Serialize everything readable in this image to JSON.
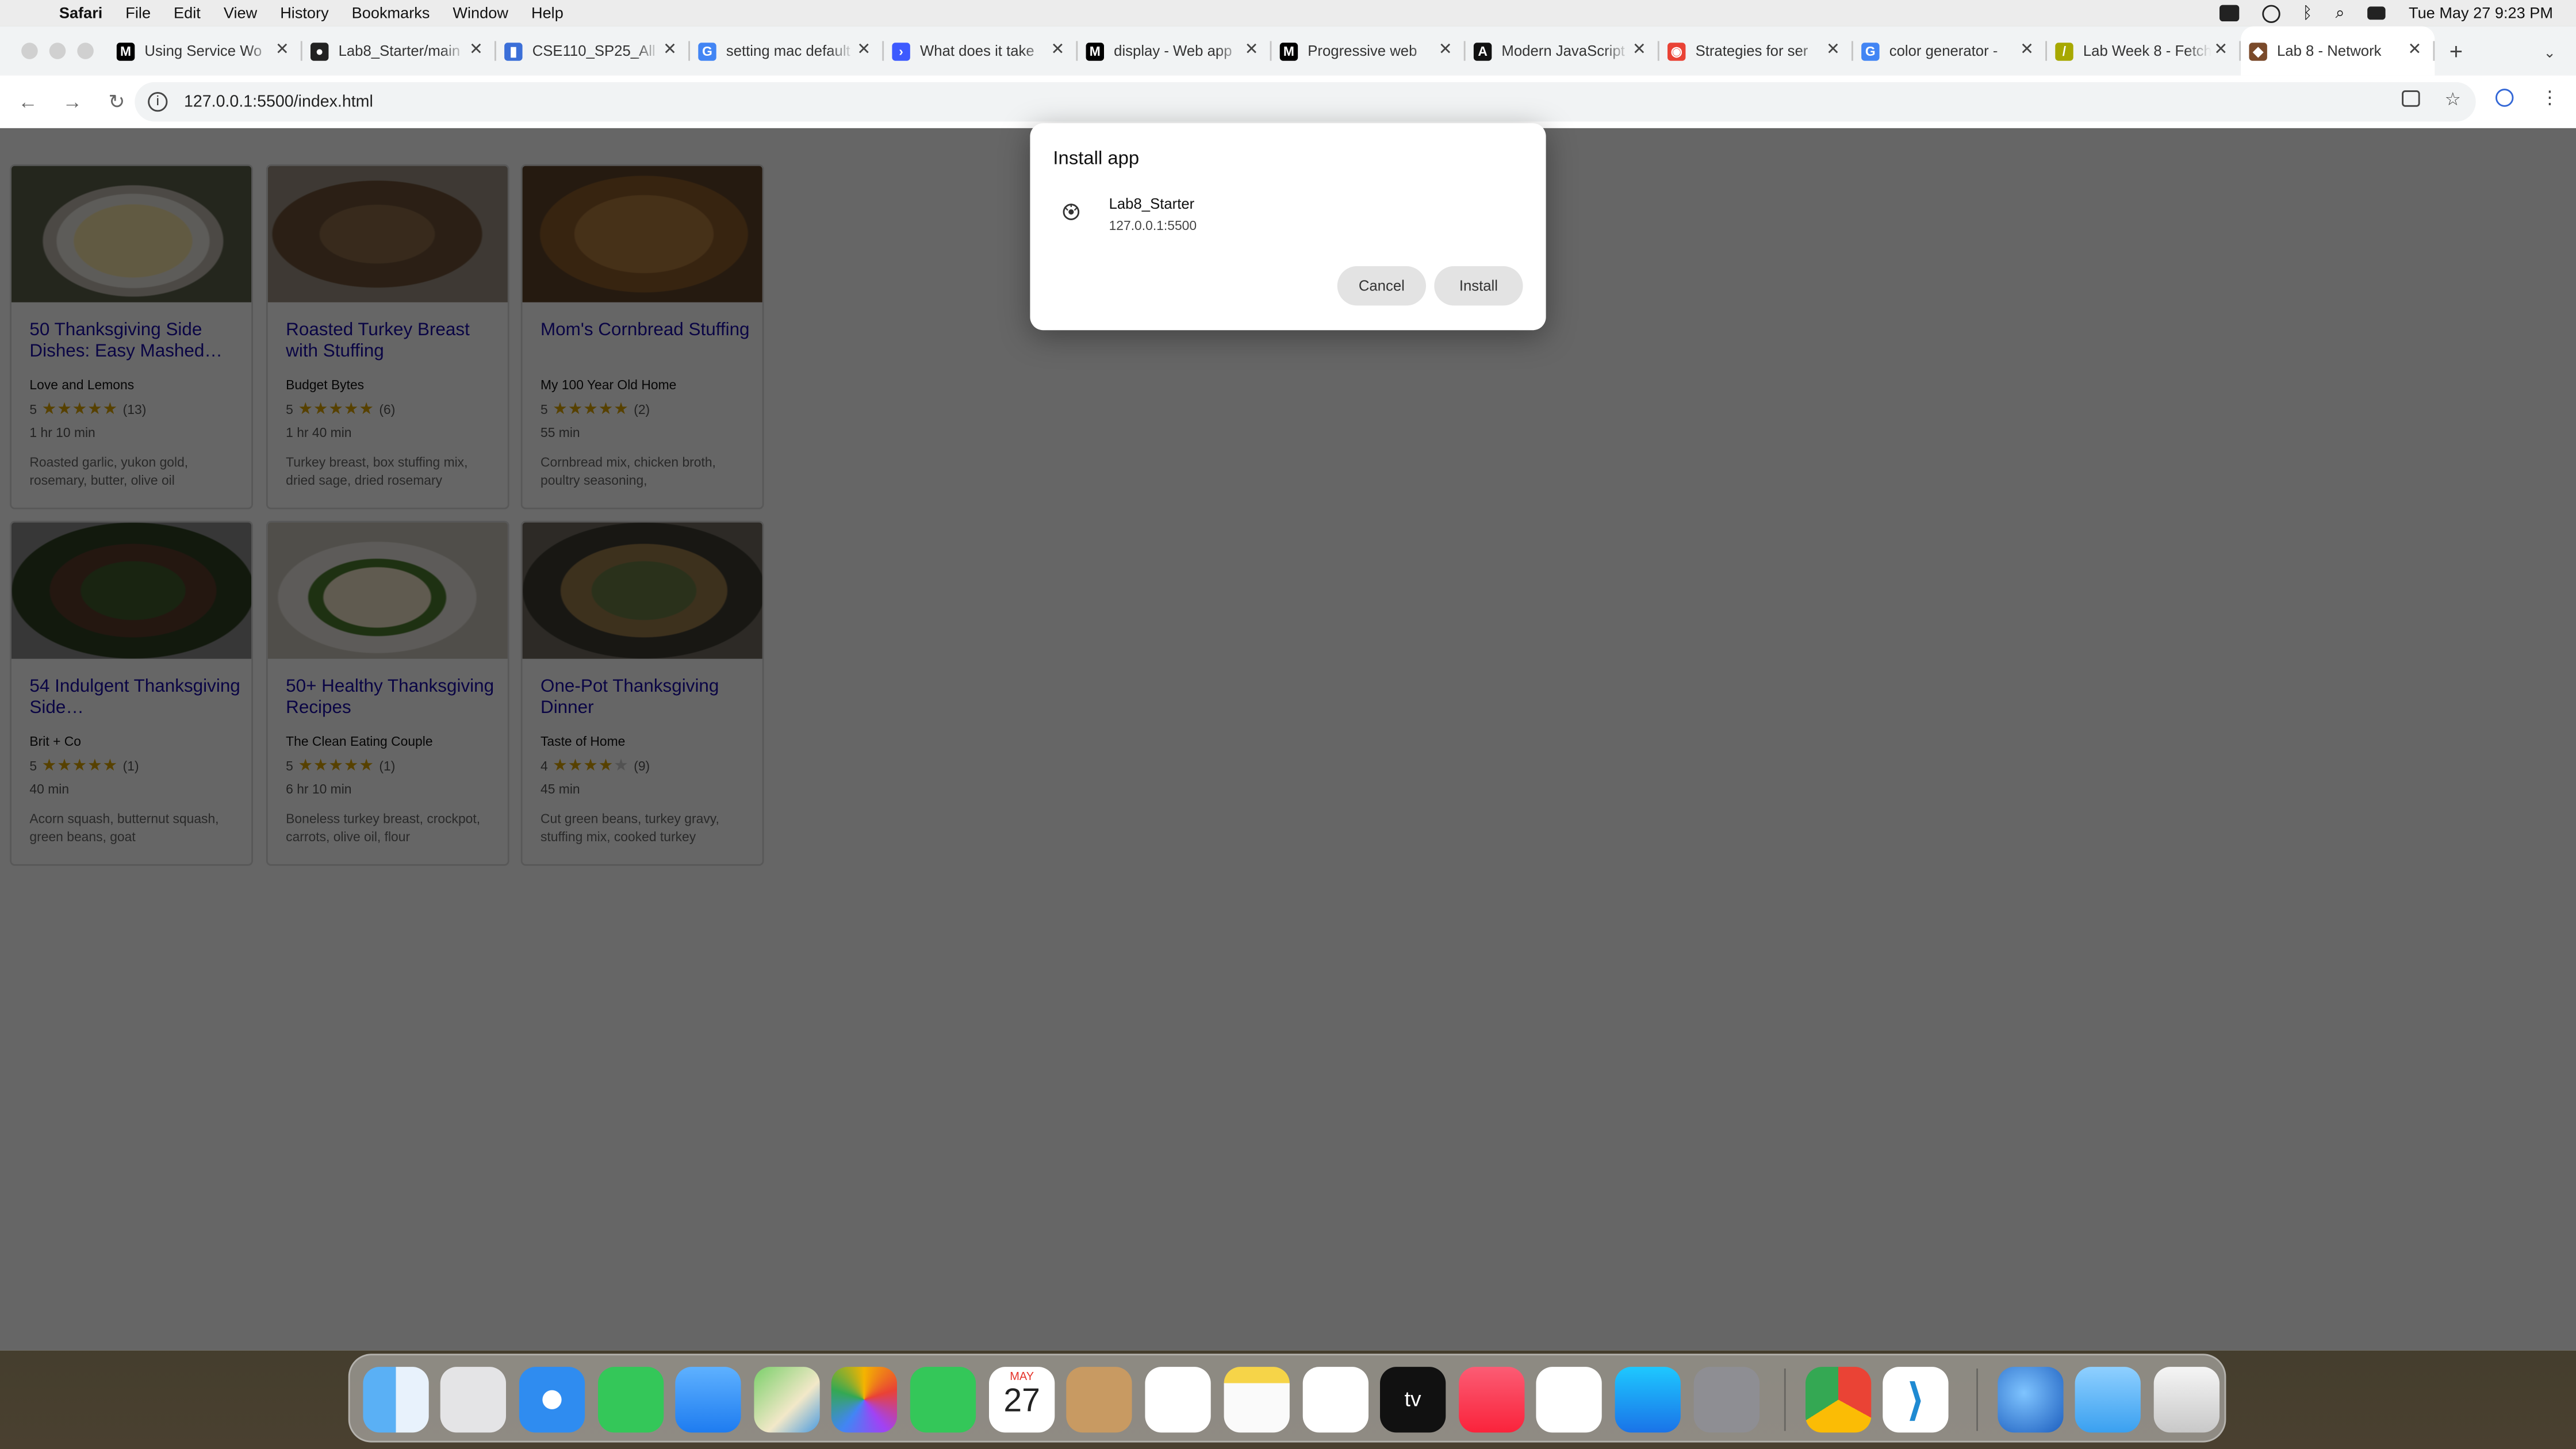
{
  "menubar": {
    "app": "Safari",
    "items": [
      "File",
      "Edit",
      "View",
      "History",
      "Bookmarks",
      "Window",
      "Help"
    ],
    "clock": "Tue May 27  9:23 PM"
  },
  "tabs": [
    {
      "label": "Using Service Wo",
      "icon": "M",
      "color": "#000"
    },
    {
      "label": "Lab8_Starter/main",
      "icon": "gh",
      "color": "#222"
    },
    {
      "label": "CSE110_SP25_All",
      "icon": "bar",
      "color": "#3b6fd8"
    },
    {
      "label": "setting mac default",
      "icon": "G",
      "color": "#4285f4"
    },
    {
      "label": "What does it take",
      "icon": "arrow",
      "color": "#3d5afe"
    },
    {
      "label": "display - Web app",
      "icon": "M",
      "color": "#000"
    },
    {
      "label": "Progressive web",
      "icon": "M",
      "color": "#000"
    },
    {
      "label": "Modern JavaScript",
      "icon": "A",
      "color": "#111"
    },
    {
      "label": "Strategies for ser",
      "icon": "chrome",
      "color": "#e94235"
    },
    {
      "label": "color generator -",
      "icon": "G",
      "color": "#4285f4"
    },
    {
      "label": "Lab Week 8 - Fetch",
      "icon": "slash",
      "color": "#a7a800"
    },
    {
      "label": "Lab 8 - Network",
      "icon": "turkey",
      "color": "#7a4a2a"
    }
  ],
  "url": "127.0.0.1:5500/index.html",
  "recipes": [
    {
      "title": "50 Thanksgiving Side Dishes: Easy Mashed…",
      "org": "Love and Lemons",
      "rating": 5,
      "count": "(13)",
      "time": "1 hr 10 min",
      "ingredients": "Roasted garlic, yukon gold, rosemary, butter, olive oil",
      "img": "mash"
    },
    {
      "title": "Roasted Turkey Breast with Stuffing",
      "org": "Budget Bytes",
      "rating": 5,
      "count": "(6)",
      "time": "1 hr 40 min",
      "ingredients": "Turkey breast, box stuffing mix, dried sage, dried rosemary",
      "img": "turkey"
    },
    {
      "title": "Mom's Cornbread Stuffing",
      "org": "My 100 Year Old Home",
      "rating": 5,
      "count": "(2)",
      "time": "55 min",
      "ingredients": "Cornbread mix, chicken broth, poultry seasoning,",
      "img": "stuffing"
    },
    {
      "title": "54 Indulgent Thanksgiving Side…",
      "org": "Brit + Co",
      "rating": 5,
      "count": "(1)",
      "time": "40 min",
      "ingredients": "Acorn squash, butternut squash, green beans, goat",
      "img": "beans"
    },
    {
      "title": "50+ Healthy Thanksgiving Recipes",
      "org": "The Clean Eating Couple",
      "rating": 5,
      "count": "(1)",
      "time": "6 hr 10 min",
      "ingredients": "Boneless turkey breast, crockpot, carrots, olive oil, flour",
      "img": "plate"
    },
    {
      "title": "One-Pot Thanksgiving Dinner",
      "org": "Taste of Home",
      "rating": 4,
      "count": "(9)",
      "time": "45 min",
      "ingredients": "Cut green beans, turkey gravy, stuffing mix, cooked turkey",
      "img": "pot"
    }
  ],
  "dialog": {
    "title": "Install app",
    "app_name": "Lab8_Starter",
    "app_url": "127.0.0.1:5500",
    "cancel": "Cancel",
    "install": "Install"
  },
  "dock": [
    "finder",
    "launchpad",
    "safari",
    "messages",
    "mail",
    "maps",
    "photos",
    "facetime",
    "calendar",
    "contacts",
    "reminders",
    "notes",
    "freeform",
    "tv",
    "music",
    "news",
    "app-store",
    "system-settings",
    "chrome",
    "vscode",
    "globe",
    "files",
    "trash"
  ],
  "calendar": {
    "month": "MAY",
    "day": "27"
  }
}
